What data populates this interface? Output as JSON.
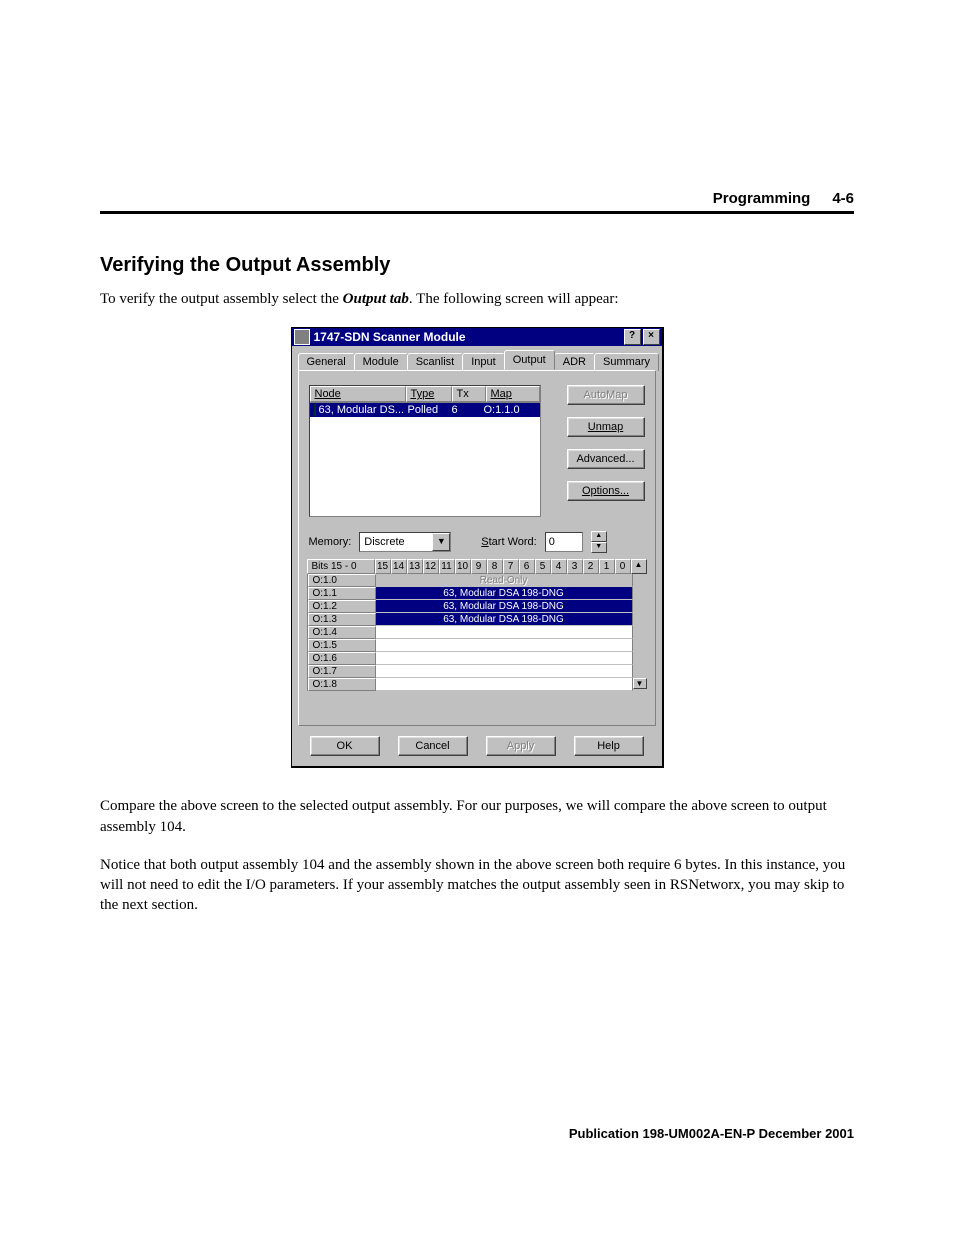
{
  "header": {
    "section": "Programming",
    "pagenum": "4-6"
  },
  "title": "Verifying the Output Assembly",
  "intro_pre": "To verify the output assembly select the ",
  "intro_tab": "Output tab",
  "intro_post": ". The following screen will appear:",
  "dialog": {
    "title": "1747-SDN Scanner Module",
    "help_btn": "?",
    "close_btn": "×",
    "tabs": [
      "General",
      "Module",
      "Scanlist",
      "Input",
      "Output",
      "ADR",
      "Summary"
    ],
    "selected_tab_index": 4,
    "node_headers": {
      "node": "Node",
      "type": "Type",
      "tx": "Tx",
      "map": "Map"
    },
    "node_row": {
      "node": "63, Modular DS...",
      "type": "Polled",
      "tx": "6",
      "map": "O:1.1.0"
    },
    "buttons": {
      "automap": "AutoMap",
      "unmap": "Unmap",
      "advanced": "Advanced...",
      "options": "Options..."
    },
    "memory_label": "Memory:",
    "memory_value": "Discrete",
    "startword_label": "Start Word:",
    "startword_value": "0",
    "bits_label": "Bits 15 - 0",
    "bit_cols": [
      "15",
      "14",
      "13",
      "12",
      "11",
      "10",
      "9",
      "8",
      "7",
      "6",
      "5",
      "4",
      "3",
      "2",
      "1",
      "0"
    ],
    "rows": [
      {
        "label": "O:1.0",
        "text": "Read-Only",
        "cls": "readonly"
      },
      {
        "label": "O:1.1",
        "text": "63, Modular DSA 198-DNG",
        "cls": "mapped"
      },
      {
        "label": "O:1.2",
        "text": "63, Modular DSA 198-DNG",
        "cls": "mapped"
      },
      {
        "label": "O:1.3",
        "text": "63, Modular DSA 198-DNG",
        "cls": "mapped"
      },
      {
        "label": "O:1.4",
        "text": "",
        "cls": ""
      },
      {
        "label": "O:1.5",
        "text": "",
        "cls": ""
      },
      {
        "label": "O:1.6",
        "text": "",
        "cls": ""
      },
      {
        "label": "O:1.7",
        "text": "",
        "cls": ""
      },
      {
        "label": "O:1.8",
        "text": "",
        "cls": ""
      }
    ],
    "ok": "OK",
    "cancel": "Cancel",
    "apply": "Apply",
    "help": "Help"
  },
  "para2": "Compare the above screen to the selected output assembly. For our purposes, we will compare the above screen to output assembly 104.",
  "para3": "Notice that both output assembly 104 and the assembly shown in the above screen both require 6 bytes. In this instance, you will not need to edit the I/O parameters. If your assembly matches the output assembly seen in RSNetworx, you may skip to the next section.",
  "footer": "Publication 198-UM002A-EN-P  December 2001"
}
